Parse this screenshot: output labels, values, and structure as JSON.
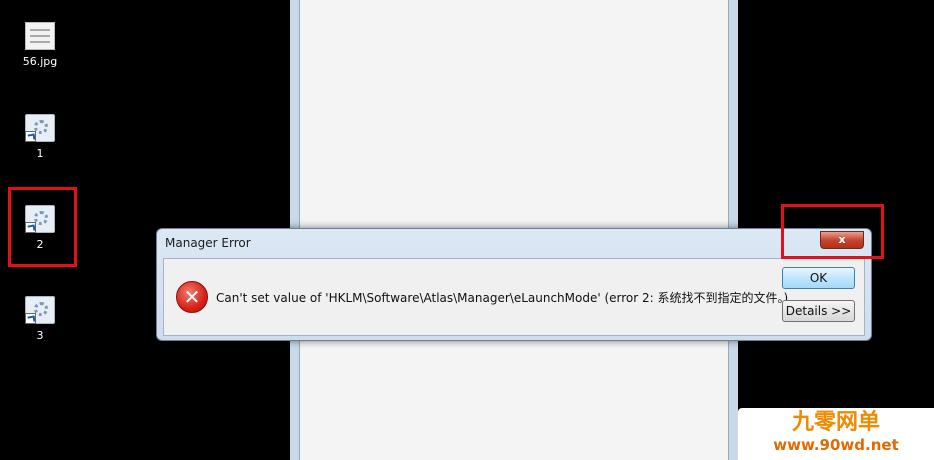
{
  "desktop": {
    "icons": [
      {
        "label": "56.jpg",
        "type": "image-file"
      },
      {
        "label": "1",
        "type": "app-shortcut"
      },
      {
        "label": "2",
        "type": "app-shortcut"
      },
      {
        "label": "3",
        "type": "app-shortcut"
      }
    ]
  },
  "dialog": {
    "title": "Manager Error",
    "close_glyph": "x",
    "icon": "error-icon",
    "message": "Can't set value of 'HKLM\\Software\\Atlas\\Manager\\eLaunchMode' (error 2: 系统找不到指定的文件。)",
    "ok_label": "OK",
    "details_label": "Details >>"
  },
  "watermark": {
    "brand": "九零网单",
    "url": "www.90wd.net"
  },
  "colors": {
    "highlight": "#e3101b",
    "close_button": "#c7452f",
    "watermark_text": "#f08a00"
  }
}
